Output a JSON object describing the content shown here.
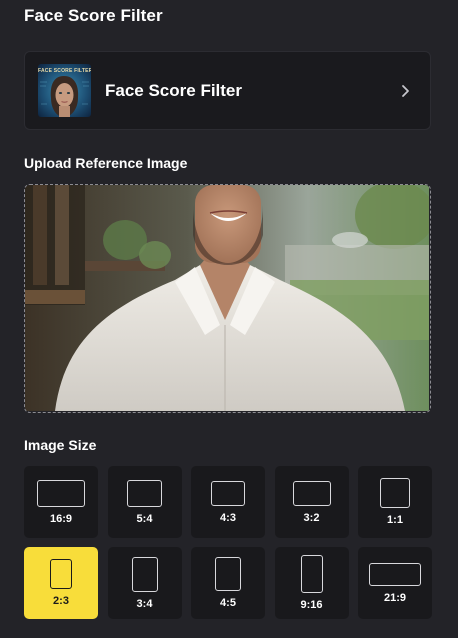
{
  "page": {
    "title": "Face Score Filter"
  },
  "model": {
    "name": "Face Score Filter",
    "thumbnail_caption": "FACE SCORE FILTER",
    "chevron_icon": "chevron-right-icon"
  },
  "upload": {
    "label": "Upload Reference Image",
    "image_description": "smiling-man-white-shirt-cafe"
  },
  "image_size": {
    "label": "Image Size",
    "selected": "2:3",
    "options": [
      {
        "label": "16:9"
      },
      {
        "label": "5:4"
      },
      {
        "label": "4:3"
      },
      {
        "label": "3:2"
      },
      {
        "label": "1:1"
      },
      {
        "label": "2:3"
      },
      {
        "label": "3:4"
      },
      {
        "label": "4:5"
      },
      {
        "label": "9:16"
      },
      {
        "label": "21:9"
      }
    ]
  },
  "colors": {
    "background": "#232328",
    "card": "#1a1a1e",
    "accent_selected": "#f8dd3a",
    "text": "#ffffff"
  }
}
